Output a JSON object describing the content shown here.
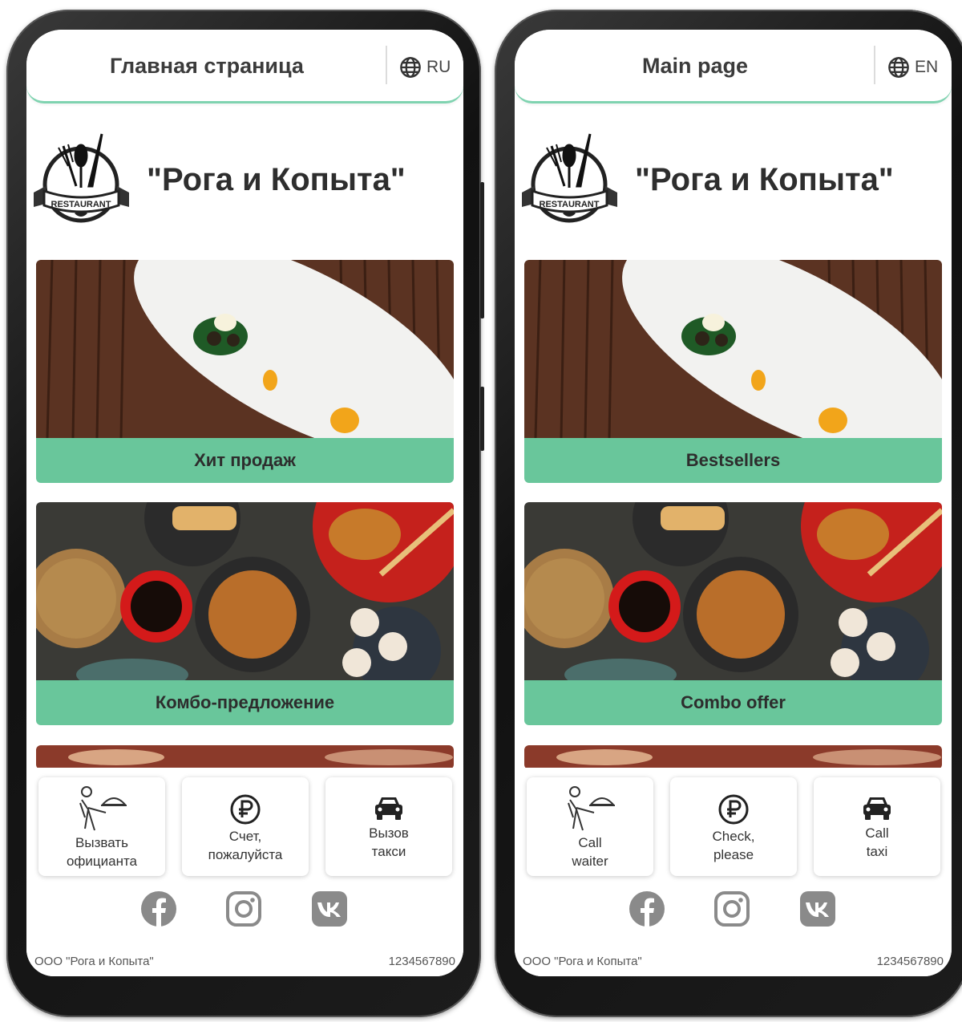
{
  "screens": [
    {
      "page_title": "Главная страница",
      "lang_code": "RU",
      "restaurant_name": "\"Рога и Копыта\"",
      "logo_text": "RESTAURANT",
      "cards": [
        {
          "label": "Хит продаж"
        },
        {
          "label": "Комбо-предложение"
        }
      ],
      "actions": [
        {
          "line1": "Вызвать",
          "line2": "официанта"
        },
        {
          "line1": "Счет,",
          "line2": "пожалуйста"
        },
        {
          "line1": "Вызов",
          "line2": "такси"
        }
      ],
      "footer": {
        "company": "ООО \"Рога и Копыта\"",
        "phone": "1234567890"
      }
    },
    {
      "page_title": "Main page",
      "lang_code": "EN",
      "restaurant_name": "\"Рога и Копыта\"",
      "logo_text": "RESTAURANT",
      "cards": [
        {
          "label": "Bestsellers"
        },
        {
          "label": "Combo offer"
        }
      ],
      "actions": [
        {
          "line1": "Call",
          "line2": "waiter"
        },
        {
          "line1": "Check,",
          "line2": "please"
        },
        {
          "line1": "Call",
          "line2": "taxi"
        }
      ],
      "footer": {
        "company": "ООО \"Рога и Копыта\"",
        "phone": "1234567890"
      }
    }
  ],
  "icons": {
    "language": "globe-icon",
    "action_1": "waiter-icon",
    "action_2": "ruble-icon",
    "action_3": "car-icon",
    "social": [
      "facebook-icon",
      "instagram-icon",
      "vk-icon"
    ]
  },
  "colors": {
    "accent_green": "#69c69b",
    "header_underline": "#7fd3b0",
    "icon_gray": "#8a8a8a"
  }
}
